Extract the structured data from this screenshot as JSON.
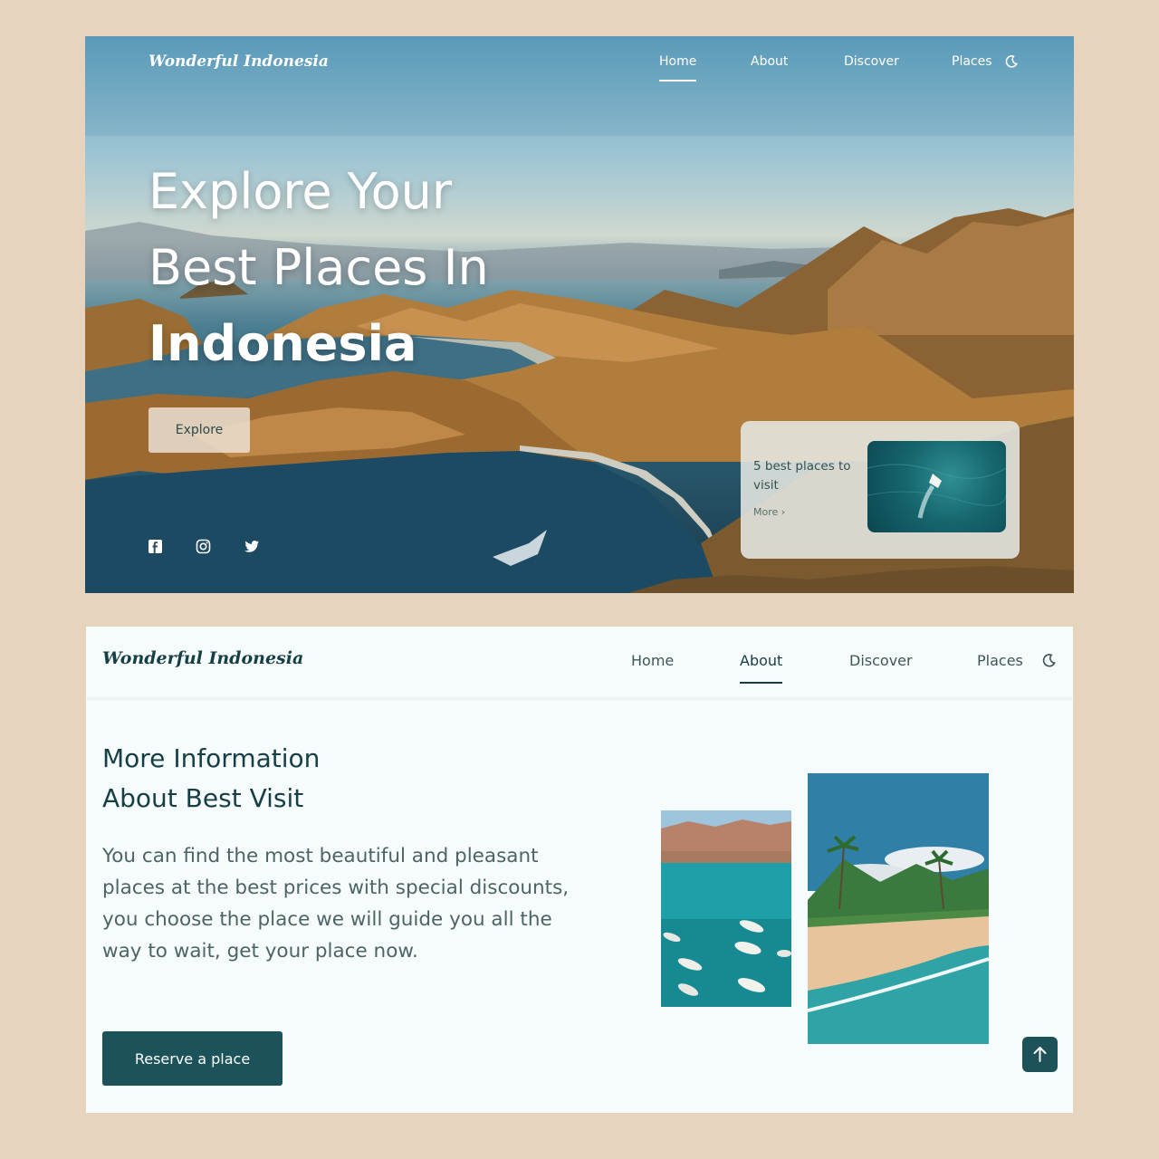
{
  "hero": {
    "logo": "Wonderful Indonesia",
    "nav": [
      {
        "label": "Home"
      },
      {
        "label": "About"
      },
      {
        "label": "Discover"
      },
      {
        "label": "Places"
      }
    ],
    "active_nav": "Home",
    "moon_icon": "moon-icon",
    "title_lines": [
      "Explore Your",
      "Best Places In",
      "Indonesia"
    ],
    "explore_label": "Explore",
    "social_icons": [
      "facebook-icon",
      "instagram-icon",
      "twitter-icon"
    ],
    "card": {
      "text": "5 best places to visit",
      "more_label": "More ›"
    }
  },
  "about": {
    "logo": "Wonderful Indonesia",
    "nav": [
      {
        "label": "Home"
      },
      {
        "label": "About"
      },
      {
        "label": "Discover"
      },
      {
        "label": "Places"
      }
    ],
    "active_nav": "About",
    "heading_lines": [
      "More Information",
      "About Best Visit"
    ],
    "description": "You can find the most beautiful and pleasant places at the best prices with special discounts, you choose the place we will guide you all the way to wait, get your place now.",
    "reserve_label": "Reserve a place",
    "scroll_top_icon": "arrow-up-icon"
  },
  "colors": {
    "page_bg": "#e6d4bf",
    "accent": "#1c5259",
    "heading": "#163f45",
    "section_bg": "#f6fcfb"
  }
}
